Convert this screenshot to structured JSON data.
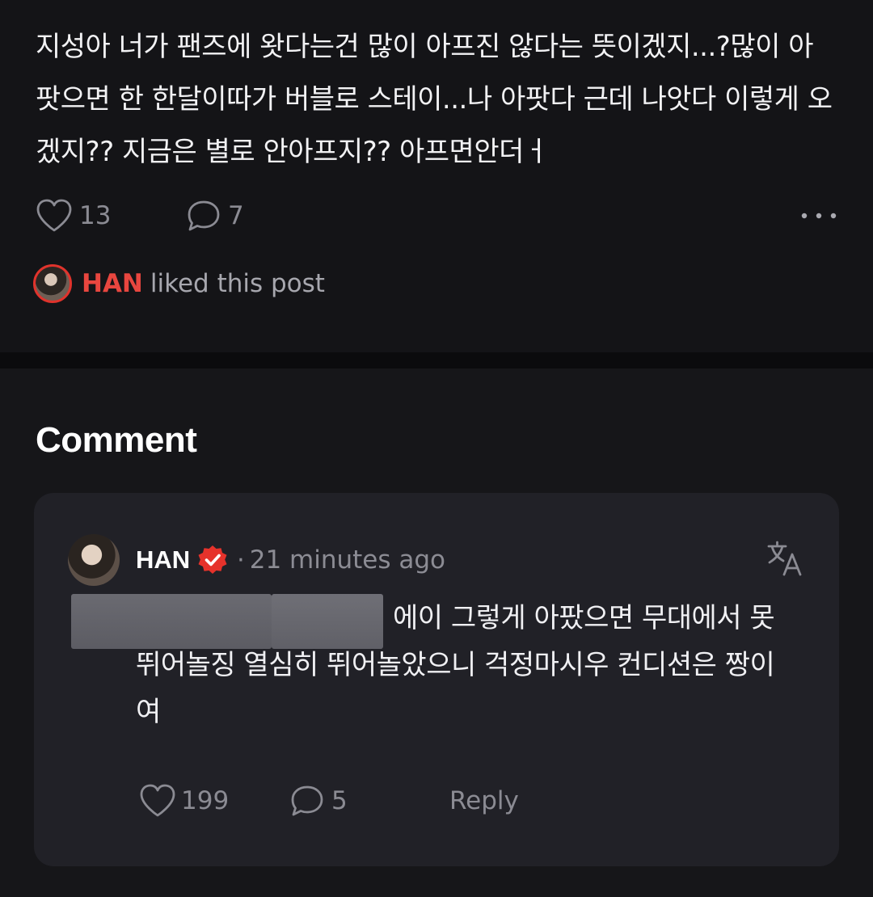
{
  "post": {
    "text": "지성아 너가 팬즈에 왓다는건 많이 아프진 않다는 뜻이겠지...?많이 아팟으면 한 한달이따가 버블로 스테이...나 아팟다 근데 나앗다 이렇게 오겠지?? 지금은 별로 안아프지?? 아프면안더ㅓ",
    "like_count": "13",
    "comment_count": "7",
    "liked_by": {
      "name": "HAN",
      "suffix": "liked this post"
    }
  },
  "comments_section": {
    "title": "Comment",
    "comment": {
      "author": "HAN",
      "dot": "·",
      "time": "21 minutes ago",
      "text": "에이 그렇게 아팠으면 무대에서 못뛰어놀징 열심히 뛰어놀았으니 걱정마시우 컨디션은 짱이여",
      "like_count": "199",
      "reply_count": "5",
      "reply_label": "Reply"
    }
  },
  "colors": {
    "accent": "#e8463f",
    "background": "#141417",
    "card": "#212127",
    "muted_text": "#8b8b93"
  },
  "icons": {
    "like": "heart-outline-icon",
    "comment": "speech-bubble-icon",
    "more": "more-dots-icon",
    "verified": "verified-badge-icon",
    "translate": "translate-icon"
  }
}
